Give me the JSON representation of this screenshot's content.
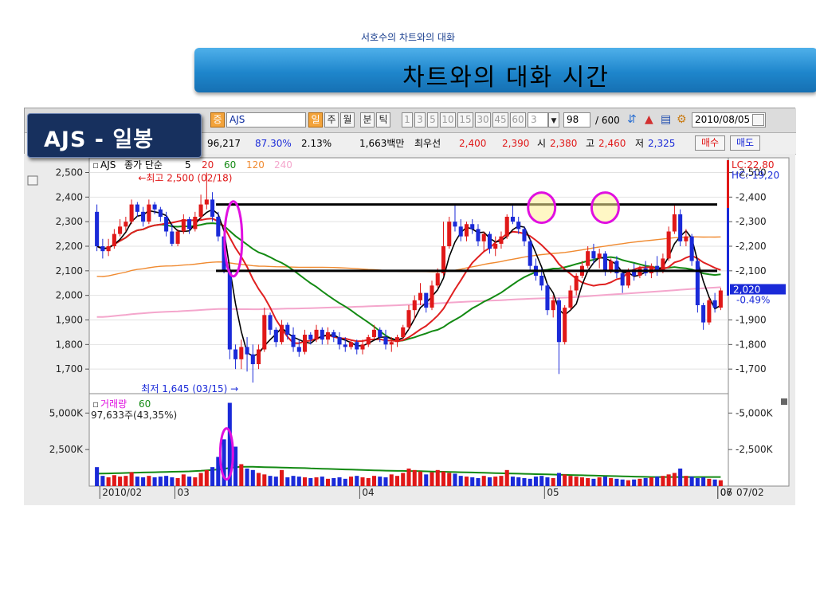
{
  "header": {
    "subtitle": "서호수의 차트와의 대화",
    "title": "차트와의 대화 시간"
  },
  "badge": {
    "label": "AJS - 일봉"
  },
  "toolbar": {
    "stock_code_tag": "증",
    "stock_code": "AJS",
    "period_buttons": [
      "일",
      "주",
      "월"
    ],
    "selected_period": "일",
    "minute_buttons": [
      "분",
      "틱"
    ],
    "interval_buttons": [
      "1",
      "3",
      "5",
      "10",
      "15",
      "30",
      "45",
      "60"
    ],
    "interval_input": "3",
    "count_value": "98",
    "count_total": "/ 600",
    "date_value": "2010/08/05"
  },
  "info_bar": {
    "volume_fragment": "96,217",
    "ratio1": "87.30%",
    "ratio2": "2.13%",
    "amount": "1,663백만",
    "best_quote_label": "최우선",
    "best_ask": "2,400",
    "best_bid": "2,390",
    "open_label": "시",
    "open_value": "2,380",
    "high_label": "고",
    "high_value": "2,460",
    "low_label": "저",
    "low_value": "2,325",
    "buy_button": "매수",
    "sell_button": "매도"
  },
  "colors": {
    "up": "#e01818",
    "down": "#1a2ad8",
    "ma5": "#000000",
    "ma20": "#e02020",
    "ma60": "#138a13",
    "ma120": "#f08a30",
    "ma240": "#f4a6cc",
    "annotation": "#e010e0"
  },
  "chart_data": [
    {
      "type": "candlestick",
      "title": "",
      "legend": {
        "ticker": "AJS",
        "label": "종가 단순",
        "periods": [
          "5",
          "20",
          "60",
          "120",
          "240"
        ]
      },
      "y_ticks": [
        "2,500",
        "2,400",
        "2,300",
        "2,200",
        "2,100",
        "2,000",
        "1,900",
        "1,800",
        "1,700"
      ],
      "right_ticks": [
        "2,500",
        "2,400",
        "2,300",
        "2,200",
        "2,100",
        "1,900",
        "1,800",
        "1,700"
      ],
      "ylim": [
        1600,
        2560
      ],
      "x_labels": [
        "2010/02",
        "03",
        "04",
        "05",
        "06",
        "07"
      ],
      "x_label_days": [
        1,
        14,
        46,
        78,
        110,
        142
      ],
      "right_axis_date": "07/02",
      "top_right_readout": [
        "LC:22,80",
        "HC:-19,20"
      ],
      "current_price": "2,020",
      "current_change": "-0.49%",
      "annotations": [
        {
          "text": "최고 2,500 (02/18)",
          "value": 2500
        },
        {
          "text": "최저 1,645 (03/15)",
          "value": 1645
        }
      ],
      "resistance_level": 2370,
      "support_level": 2100,
      "highlight_peaks_day": [
        77,
        88,
        134
      ],
      "highlight_gap_day": 25,
      "candles": [
        [
          2340,
          2370,
          2180,
          2200
        ],
        [
          2200,
          2230,
          2150,
          2180
        ],
        [
          2180,
          2230,
          2160,
          2200
        ],
        [
          2200,
          2270,
          2190,
          2250
        ],
        [
          2250,
          2310,
          2240,
          2280
        ],
        [
          2280,
          2320,
          2260,
          2300
        ],
        [
          2300,
          2390,
          2290,
          2370
        ],
        [
          2370,
          2380,
          2320,
          2340
        ],
        [
          2340,
          2360,
          2280,
          2300
        ],
        [
          2300,
          2390,
          2290,
          2370
        ],
        [
          2370,
          2380,
          2330,
          2350
        ],
        [
          2350,
          2360,
          2300,
          2320
        ],
        [
          2320,
          2340,
          2240,
          2260
        ],
        [
          2260,
          2290,
          2200,
          2210
        ],
        [
          2210,
          2270,
          2200,
          2260
        ],
        [
          2260,
          2330,
          2250,
          2310
        ],
        [
          2310,
          2320,
          2250,
          2270
        ],
        [
          2270,
          2340,
          2260,
          2320
        ],
        [
          2320,
          2410,
          2310,
          2370
        ],
        [
          2370,
          2500,
          2350,
          2390
        ],
        [
          2390,
          2420,
          2300,
          2320
        ],
        [
          2320,
          2340,
          2220,
          2240
        ],
        [
          2240,
          2250,
          2090,
          2100
        ],
        [
          2100,
          2110,
          1740,
          1780
        ],
        [
          1780,
          1800,
          1700,
          1740
        ],
        [
          1740,
          1820,
          1700,
          1790
        ],
        [
          1790,
          1830,
          1690,
          1760
        ],
        [
          1760,
          1800,
          1645,
          1720
        ],
        [
          1720,
          1800,
          1700,
          1780
        ],
        [
          1780,
          1950,
          1770,
          1920
        ],
        [
          1920,
          1930,
          1840,
          1860
        ],
        [
          1860,
          1870,
          1790,
          1810
        ],
        [
          1810,
          1900,
          1800,
          1880
        ],
        [
          1880,
          1890,
          1820,
          1840
        ],
        [
          1840,
          1870,
          1770,
          1790
        ],
        [
          1790,
          1820,
          1750,
          1770
        ],
        [
          1770,
          1860,
          1760,
          1840
        ],
        [
          1840,
          1850,
          1800,
          1820
        ],
        [
          1820,
          1880,
          1810,
          1860
        ],
        [
          1860,
          1870,
          1800,
          1820
        ],
        [
          1820,
          1870,
          1800,
          1850
        ],
        [
          1850,
          1860,
          1810,
          1830
        ],
        [
          1830,
          1850,
          1780,
          1800
        ],
        [
          1800,
          1830,
          1770,
          1790
        ],
        [
          1790,
          1820,
          1780,
          1810
        ],
        [
          1810,
          1820,
          1760,
          1780
        ],
        [
          1780,
          1820,
          1760,
          1800
        ],
        [
          1800,
          1840,
          1790,
          1830
        ],
        [
          1830,
          1880,
          1820,
          1860
        ],
        [
          1860,
          1870,
          1810,
          1830
        ],
        [
          1830,
          1860,
          1780,
          1800
        ],
        [
          1800,
          1830,
          1770,
          1810
        ],
        [
          1810,
          1840,
          1790,
          1830
        ],
        [
          1830,
          1880,
          1820,
          1870
        ],
        [
          1870,
          1960,
          1860,
          1940
        ],
        [
          1940,
          2000,
          1900,
          1980
        ],
        [
          1980,
          2050,
          1960,
          2010
        ],
        [
          2010,
          2000,
          1930,
          1950
        ],
        [
          1950,
          2060,
          1940,
          2040
        ],
        [
          2040,
          2110,
          2030,
          2090
        ],
        [
          2090,
          2300,
          2080,
          2200
        ],
        [
          2200,
          2320,
          2190,
          2300
        ],
        [
          2300,
          2370,
          2260,
          2280
        ],
        [
          2280,
          2310,
          2220,
          2240
        ],
        [
          2240,
          2300,
          2220,
          2290
        ],
        [
          2290,
          2310,
          2250,
          2270
        ],
        [
          2270,
          2290,
          2200,
          2220
        ],
        [
          2220,
          2260,
          2180,
          2250
        ],
        [
          2250,
          2260,
          2170,
          2190
        ],
        [
          2190,
          2240,
          2160,
          2210
        ],
        [
          2210,
          2260,
          2190,
          2240
        ],
        [
          2240,
          2330,
          2230,
          2320
        ],
        [
          2320,
          2370,
          2290,
          2300
        ],
        [
          2300,
          2320,
          2250,
          2270
        ],
        [
          2270,
          2280,
          2200,
          2220
        ],
        [
          2220,
          2230,
          2100,
          2120
        ],
        [
          2120,
          2150,
          2060,
          2080
        ],
        [
          2080,
          2110,
          2020,
          2040
        ],
        [
          2040,
          2050,
          1920,
          1940
        ],
        [
          1940,
          2000,
          1910,
          1980
        ],
        [
          1980,
          1990,
          1680,
          1810
        ],
        [
          1810,
          1960,
          1800,
          1950
        ],
        [
          1950,
          2040,
          1940,
          2020
        ],
        [
          2020,
          2090,
          2000,
          2080
        ],
        [
          2080,
          2140,
          2070,
          2120
        ],
        [
          2120,
          2200,
          2110,
          2180
        ],
        [
          2180,
          2210,
          2130,
          2150
        ],
        [
          2150,
          2190,
          2110,
          2170
        ],
        [
          2170,
          2180,
          2080,
          2100
        ],
        [
          2100,
          2150,
          2090,
          2140
        ],
        [
          2140,
          2160,
          2070,
          2090
        ],
        [
          2090,
          2100,
          2010,
          2040
        ],
        [
          2040,
          2110,
          2030,
          2100
        ],
        [
          2100,
          2130,
          2060,
          2080
        ],
        [
          2080,
          2120,
          2070,
          2110
        ],
        [
          2110,
          2140,
          2080,
          2090
        ],
        [
          2090,
          2130,
          2070,
          2120
        ],
        [
          2120,
          2160,
          2080,
          2100
        ],
        [
          2100,
          2170,
          2090,
          2150
        ],
        [
          2150,
          2280,
          2140,
          2260
        ],
        [
          2260,
          2370,
          2250,
          2330
        ],
        [
          2330,
          2350,
          2200,
          2220
        ],
        [
          2220,
          2270,
          2200,
          2240
        ],
        [
          2240,
          2250,
          2120,
          2140
        ],
        [
          2140,
          2150,
          1930,
          1960
        ],
        [
          1960,
          1970,
          1860,
          1890
        ],
        [
          1890,
          1990,
          1880,
          1980
        ],
        [
          1980,
          2010,
          1930,
          1950
        ],
        [
          1950,
          2030,
          1940,
          2020
        ]
      ]
    },
    {
      "type": "bar",
      "title": "",
      "legend_label": "거래량",
      "legend_period": "60",
      "readout": "97,633주(43,35%)",
      "y_ticks": [
        "5,000K",
        "2,500K"
      ],
      "ylim": [
        0,
        6000
      ],
      "values": [
        1300,
        700,
        600,
        750,
        650,
        700,
        950,
        650,
        600,
        700,
        600,
        650,
        700,
        600,
        550,
        800,
        650,
        600,
        900,
        1100,
        1300,
        2000,
        3200,
        5700,
        2700,
        1500,
        1200,
        1100,
        900,
        800,
        700,
        650,
        1100,
        600,
        700,
        650,
        600,
        550,
        600,
        650,
        500,
        550,
        600,
        500,
        650,
        700,
        600,
        550,
        700,
        650,
        600,
        800,
        700,
        900,
        1200,
        1100,
        1000,
        800,
        950,
        1100,
        1000,
        900,
        850,
        700,
        650,
        600,
        550,
        700,
        600,
        650,
        700,
        1100,
        650,
        600,
        550,
        500,
        650,
        700,
        600,
        550,
        900,
        800,
        700,
        650,
        600,
        550,
        500,
        600,
        650,
        550,
        500,
        450,
        400,
        450,
        500,
        550,
        600,
        650,
        700,
        800,
        900,
        1200,
        700,
        650,
        550,
        600,
        500,
        450,
        400
      ],
      "ma_values": [
        850,
        860,
        870,
        880,
        890,
        900,
        910,
        920,
        930,
        940,
        950,
        960,
        970,
        980,
        990,
        1000,
        1010,
        1030,
        1050,
        1080,
        1100,
        1140,
        1180,
        1250,
        1300,
        1320,
        1320,
        1320,
        1310,
        1300,
        1290,
        1280,
        1270,
        1260,
        1250,
        1240,
        1230,
        1210,
        1200,
        1190,
        1180,
        1170,
        1150,
        1140,
        1130,
        1120,
        1100,
        1090,
        1080,
        1070,
        1060,
        1050,
        1040,
        1040,
        1030,
        1030,
        1020,
        1010,
        1000,
        990,
        980,
        970,
        960,
        950,
        940,
        930,
        920,
        910,
        900,
        890,
        880,
        870,
        860,
        850,
        840,
        830,
        820,
        810,
        800,
        790,
        780,
        770,
        760,
        750,
        740,
        730,
        720,
        710,
        700,
        690,
        680,
        670,
        660,
        650,
        640,
        630,
        620,
        620,
        620,
        620,
        620,
        620,
        620,
        620,
        620,
        620,
        620,
        620,
        620
      ]
    }
  ]
}
